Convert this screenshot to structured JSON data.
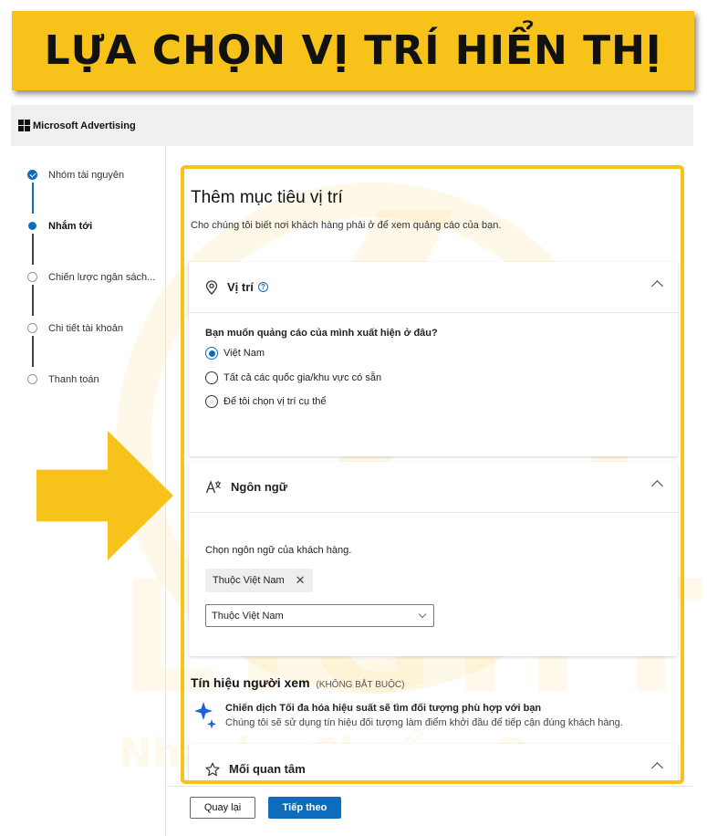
{
  "banner": {
    "title": "LỰA CHỌN VỊ TRÍ HIỂN THỊ"
  },
  "header": {
    "brand": "Microsoft Advertising"
  },
  "steps": [
    {
      "label": "Nhóm tài nguyên",
      "state": "done"
    },
    {
      "label": "Nhắm tới",
      "state": "active"
    },
    {
      "label": "Chiến lược ngân sách...",
      "state": "pending"
    },
    {
      "label": "Chi tiết tài khoản",
      "state": "pending"
    },
    {
      "label": "Thanh toán",
      "state": "pending"
    }
  ],
  "main": {
    "title": "Thêm mục tiêu vị trí",
    "subtitle": "Cho chúng tôi biết nơi khách hàng phải ở để xem quảng cáo của bạn."
  },
  "location": {
    "title": "Vị trí",
    "question": "Bạn muốn quảng cáo của mình xuất hiện ở đâu?",
    "options": [
      {
        "label": "Việt Nam",
        "checked": true
      },
      {
        "label": "Tất cả các quốc gia/khu vực có sẵn",
        "checked": false
      },
      {
        "label": "Để tôi chọn vị trí cụ thể",
        "checked": false
      }
    ]
  },
  "language": {
    "title": "Ngôn ngữ",
    "description": "Chọn ngôn ngữ của khách hàng.",
    "chip": "Thuộc Việt Nam",
    "select_value": "Thuộc Việt Nam"
  },
  "signals": {
    "title": "Tín hiệu người xem",
    "optional": "(KHÔNG BẮT BUỘC)",
    "line1": "Chiến dịch Tối đa hóa hiệu suất sẽ tìm đối tượng phù hợp với bạn",
    "line2": "Chúng tôi sẽ sử dụng tín hiệu đối tượng làm điểm khởi đầu để tiếp cận đúng khách hàng."
  },
  "interests": {
    "title": "Mối quan tâm"
  },
  "footer": {
    "back_label": "Quay lại",
    "next_label": "Tiếp theo"
  },
  "watermark": {
    "brand": "LIGHT",
    "slogan": "Nhanh - Chuẩn - Đẹp"
  },
  "colors": {
    "accent": "#0f6cbd",
    "highlight": "#f7c21a"
  },
  "icons": {
    "location": "map-pin-icon",
    "language": "translate-icon",
    "interests": "star-icon",
    "signals": "sparkle-icon",
    "help": "help-circle-icon"
  }
}
